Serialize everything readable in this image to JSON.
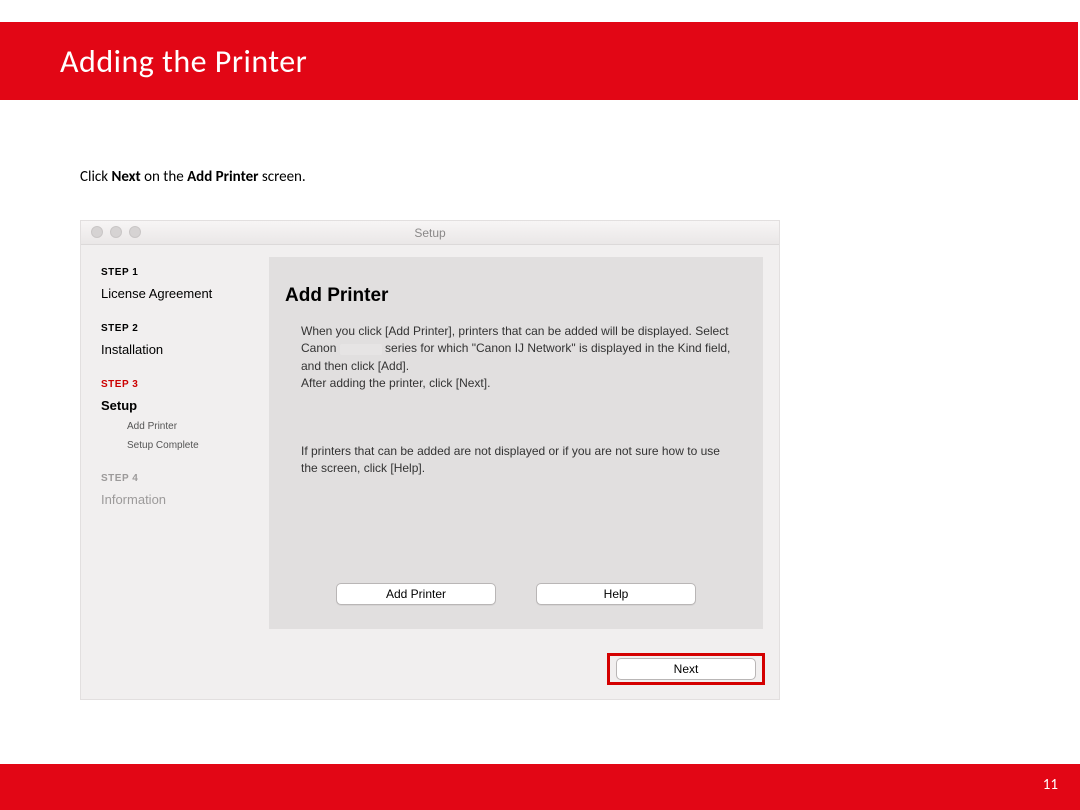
{
  "header": {
    "title": "Adding  the Printer"
  },
  "instruction": {
    "pre": "Click ",
    "bold1": "Next",
    "mid": " on the ",
    "bold2": "Add Printer",
    "post": " screen."
  },
  "window": {
    "title": "Setup",
    "sidebar": {
      "step1_label": "STEP 1",
      "step1_item": "License Agreement",
      "step2_label": "STEP 2",
      "step2_item": "Installation",
      "step3_label": "STEP 3",
      "step3_item": "Setup",
      "step3_sub1": "Add Printer",
      "step3_sub2": "Setup Complete",
      "step4_label": "STEP 4",
      "step4_item": "Information"
    },
    "content": {
      "heading": "Add Printer",
      "para1_a": "When you click [Add Printer], printers that can be added will be displayed. Select Canon ",
      "para1_b": " series for which \"Canon IJ Network\" is displayed in the Kind field, and then click [Add].",
      "para1_c": "After adding the printer, click [Next].",
      "para2": "If printers that can be added are not displayed or if you are not sure how to use the screen, click [Help].",
      "btn_add": "Add Printer",
      "btn_help": "Help"
    },
    "footer": {
      "btn_next": "Next"
    }
  },
  "page_number": "11"
}
